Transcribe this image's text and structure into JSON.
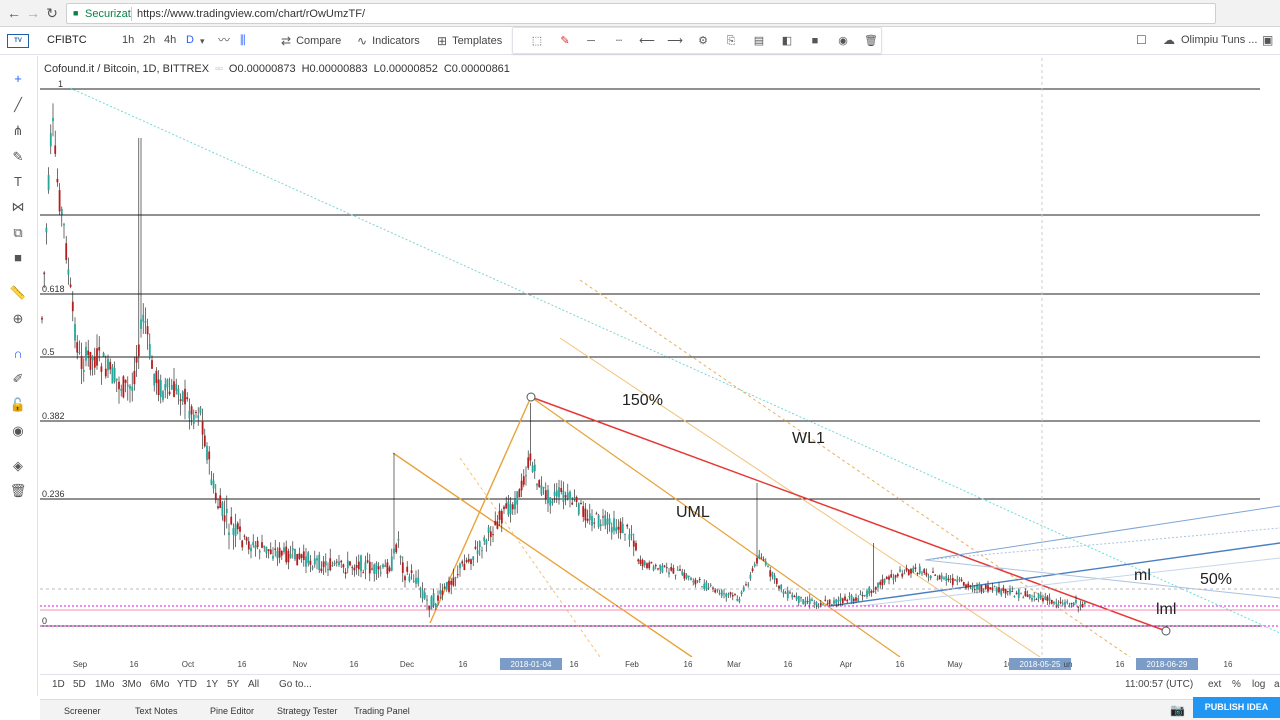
{
  "browser": {
    "secure_label": "Securizat",
    "url": "https://www.tradingview.com/chart/rOwUmzTF/"
  },
  "toolbar": {
    "symbol": "CFIBTC",
    "timeframes": [
      "1h",
      "2h",
      "4h",
      "D"
    ],
    "compare": "Compare",
    "indicators": "Indicators",
    "templates": "Templates",
    "user": "Olimpiu Tuns ..."
  },
  "legend": {
    "name": "Cofound.it / Bitcoin, 1D, BITTREX",
    "open": "O0.00000873",
    "high": "H0.00000883",
    "low": "L0.00000852",
    "close": "C0.00000861"
  },
  "chart_data": {
    "type": "candlestick",
    "fib_levels": [
      "1",
      "0.618",
      "0.5",
      "0.382",
      "0.236",
      "0"
    ],
    "annotations": [
      "150%",
      "WL1",
      "UML",
      "ml",
      "50%",
      "lml"
    ],
    "x_labels": [
      "Sep",
      "16",
      "Oct",
      "16",
      "Nov",
      "16",
      "Dec",
      "16",
      "2018-01-04",
      "16",
      "Feb",
      "16",
      "Mar",
      "16",
      "Apr",
      "16",
      "May",
      "16",
      "2018-05-25",
      "un",
      "16",
      "2018-06-29",
      "16"
    ],
    "highlighted_x_labels": [
      "2018-01-04",
      "2018-05-25",
      "2018-06-29"
    ],
    "colors": {
      "up": "#26a69a",
      "down": "#b71c1c",
      "fork": "#e8a23a",
      "trend": "#e53935",
      "pitchfork_blue": "#4a7fc1"
    }
  },
  "ranges": [
    "1D",
    "5D",
    "1Mo",
    "3Mo",
    "6Mo",
    "YTD",
    "1Y",
    "5Y",
    "All"
  ],
  "goto": "Go to...",
  "time": "11:00:57 (UTC)",
  "scale_opts": [
    "ext",
    "%",
    "log",
    "auto"
  ],
  "panels": [
    "Screener",
    "Text Notes",
    "Pine Editor",
    "Strategy Tester",
    "Trading Panel"
  ],
  "publish": "PUBLISH IDEA"
}
